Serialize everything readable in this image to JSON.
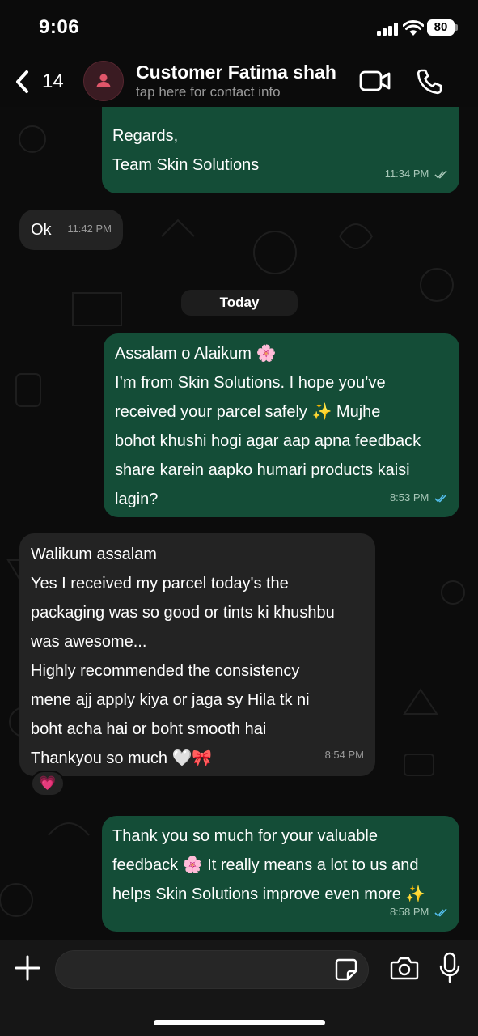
{
  "status_bar": {
    "time": "9:06",
    "battery": "80"
  },
  "header": {
    "back_count": "14",
    "contact_name": "Customer Fatima shah",
    "subtitle": "tap here for contact info"
  },
  "chat": {
    "day_divider": "Today",
    "messages": [
      {
        "direction": "outgoing",
        "text": "Regards,\nTeam Skin Solutions",
        "time": "11:34 PM",
        "status": "delivered"
      },
      {
        "direction": "incoming",
        "text": "Ok",
        "time": "11:42 PM"
      },
      {
        "direction": "outgoing",
        "text": "Assalam o Alaikum 🌸\nI’m from Skin Solutions. I hope you’ve\nreceived your parcel safely ✨ Mujhe\nbohot khushi hogi agar aap apna feedback\nshare karein aapko humari products kaisi\nlagin?",
        "time": "8:53 PM",
        "status": "read"
      },
      {
        "direction": "incoming",
        "text": "Walikum assalam\nYes I received my parcel today's the\npackaging was so good or tints ki khushbu\nwas awesome...\nHighly recommended the consistency\nmene ajj apply kiya or jaga sy Hila tk ni\nboht acha hai or boht smooth hai\nThankyou so much 🤍🎀",
        "time": "8:54 PM",
        "reaction": "💗"
      },
      {
        "direction": "outgoing",
        "text": "Thank you so much for your valuable\nfeedback 🌸 It really means a lot to us and\nhelps Skin Solutions improve even more ✨",
        "time": "8:58 PM",
        "status": "read"
      }
    ]
  },
  "icons": [
    "back-chevron-icon",
    "contact-avatar-icon",
    "video-call-icon",
    "phone-call-icon",
    "plus-icon",
    "sticker-icon",
    "camera-icon",
    "microphone-icon"
  ],
  "colors": {
    "outgoing_bubble": "#144d37",
    "incoming_bubble": "#232323",
    "read_tick": "#53bdeb",
    "background": "#0b0b0b"
  }
}
